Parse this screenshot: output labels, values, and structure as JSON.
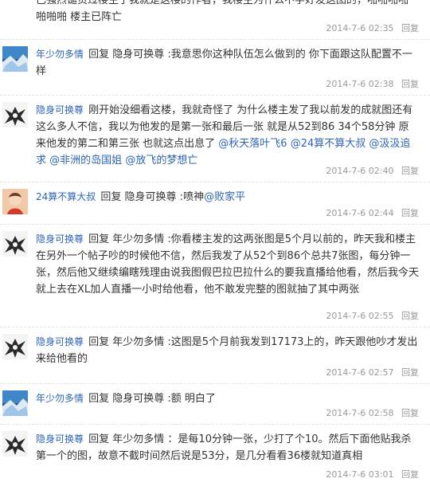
{
  "posts": [
    {
      "author": "",
      "avatar": "none",
      "segments": [
        {
          "text": "已强烈谴责过楼主了我就是这楼的作者，我楼主为什么不学好发这图的"
        },
        {
          "text": "，啪啪啪啪啪啪啪 楼主已阵亡"
        }
      ],
      "time": "2014-7-6 02:35",
      "reply_label": "回复"
    },
    {
      "author": "年少勿多情",
      "avatar": "blue-landscape",
      "segments": [
        {
          "text": "回复 隐身可换尊 :我意思你这种队伍怎么做到的 你下面跟这队配置不一样"
        }
      ],
      "time": "2014-7-6 02:38",
      "reply_label": "回复"
    },
    {
      "author": "隐身可换尊",
      "avatar": "dark-emblem",
      "segments": [
        {
          "text": "刚开始没细看这楼，我就奇怪了 为什么楼主发了我以前发的成就图还有这么多人不信，我以为他发的是第一张和最后一张 就是从52到86 34个58分钟 原来他发的第二和第三张 也就这点出息了 "
        },
        {
          "text": "@秋天落叶飞6",
          "mention": true
        },
        {
          "text": " "
        },
        {
          "text": "@24算不算大叔",
          "mention": true
        },
        {
          "text": " "
        },
        {
          "text": "@汲汲追求",
          "mention": true
        },
        {
          "text": " "
        },
        {
          "text": "@非洲的岛国姐",
          "mention": true
        },
        {
          "text": " "
        },
        {
          "text": "@放飞的梦想亡",
          "mention": true
        }
      ],
      "time": "2014-7-6 02:40",
      "reply_label": "回复"
    },
    {
      "author": "24算不算大叔",
      "avatar": "child-photo",
      "segments": [
        {
          "text": "回复 隐身可换尊 :喷神"
        },
        {
          "text": "@败家平",
          "mention": true
        }
      ],
      "time": "2014-7-6 02:44",
      "reply_label": "回复"
    },
    {
      "author": "隐身可换尊",
      "avatar": "dark-emblem",
      "segments": [
        {
          "text": "回复 年少勿多情 :你看楼主发的这两张图是5个月以前的，昨天我和楼主在另外一个帖子吵的时候他不信，然后我发了从52个到86个总共7张图，每分钟一张，然后他又继续编瞎残理由说我图假巴拉巴拉什么的要我直播给他看，然后我今天就上去在XL加人直播一小时给他看，他不敢发完整的图就抽了其中两张"
        }
      ],
      "time": "2014-7-6 02:55",
      "reply_label": "回复"
    },
    {
      "author": "隐身可换尊",
      "avatar": "dark-emblem",
      "segments": [
        {
          "text": "回复 年少勿多情 :这图是5个月前我发到17173上的，昨天跟他吵才发出来给他看的"
        }
      ],
      "time": "2014-7-6 02:57",
      "reply_label": "回复"
    },
    {
      "author": "年少勿多情",
      "avatar": "blue-landscape",
      "segments": [
        {
          "text": "回复 隐身可换尊 :额 明白了"
        }
      ],
      "time": "2014-7-6 02:58",
      "reply_label": "回复"
    },
    {
      "author": "隐身可换尊",
      "avatar": "dark-emblem",
      "segments": [
        {
          "text": "回复 年少勿多情 ：是每10分钟一张，少打了个10。然后下面他贴我杀第一个的图，故意不截时间然后说是53分，是几分看看36楼就知道真相"
        }
      ],
      "time": "2014-7-6 03:01",
      "reply_label": "回复"
    }
  ]
}
